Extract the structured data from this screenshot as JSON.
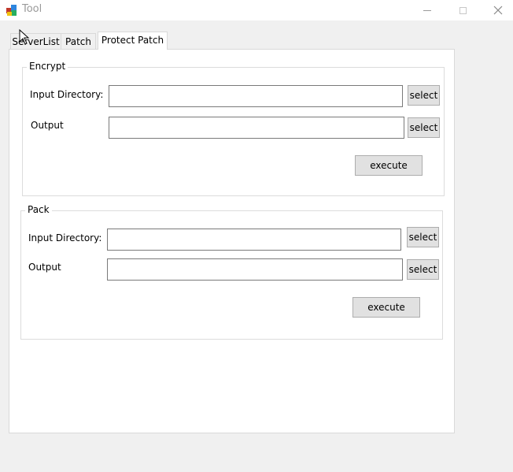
{
  "window": {
    "title": "Tool"
  },
  "tabs": [
    {
      "label": "ServerList"
    },
    {
      "label": "Patch"
    },
    {
      "label": "Protect Patch"
    }
  ],
  "encrypt": {
    "legend": "Encrypt",
    "input_label": "Input Directory:",
    "input_value": "",
    "output_label": "Output",
    "output_value": "",
    "select_label": "select",
    "execute_label": "execute"
  },
  "pack": {
    "legend": "Pack",
    "input_label": "Input Directory:",
    "input_value": "",
    "output_label": "Output",
    "output_value": "",
    "select_label": "select",
    "execute_label": "execute"
  }
}
